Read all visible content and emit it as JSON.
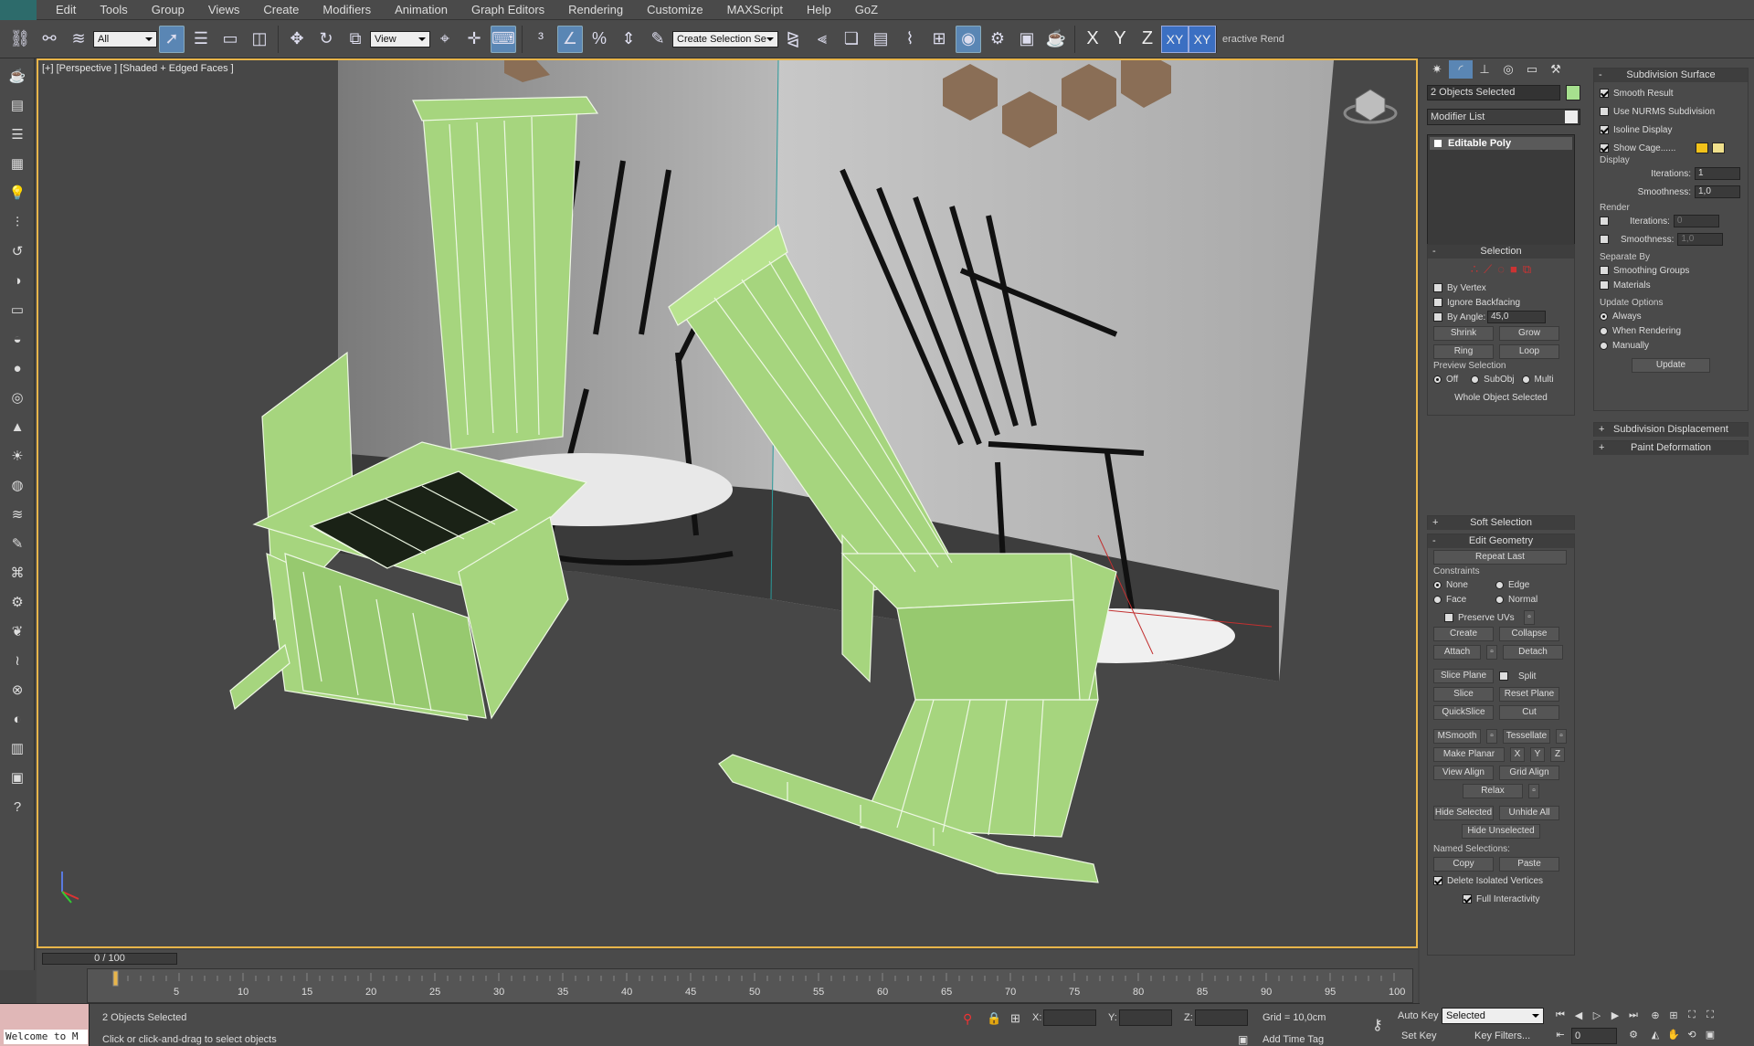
{
  "menu": [
    "Edit",
    "Tools",
    "Group",
    "Views",
    "Create",
    "Modifiers",
    "Animation",
    "Graph Editors",
    "Rendering",
    "Customize",
    "MAXScript",
    "Help",
    "GoZ"
  ],
  "toolbar": {
    "selection_filter": "All",
    "ref_coord": "View",
    "named_selection": "Create Selection Se",
    "axis_x": "X",
    "axis_y": "Y",
    "axis_z": "Z",
    "axis_xy": "XY",
    "axis_xy2": "XY",
    "interactive_label": "eractive Rend"
  },
  "viewport": {
    "label": "[+] [Perspective ] [Shaded + Edged Faces ]",
    "accent_color": "#e8b54a",
    "model_color": "#a6d57e"
  },
  "left_tools_icons": [
    "teapot-icon",
    "scene-explorer-icon",
    "layer-icon",
    "grid-icon",
    "light-icon",
    "sliders-icon",
    "rotate-icon",
    "material-icon",
    "box-icon",
    "half-sphere-icon",
    "sphere-icon",
    "torus-icon",
    "cone-icon",
    "sun-icon",
    "sphere2-icon",
    "hair-icon",
    "paint-icon",
    "cloth-icon",
    "settings-icon",
    "plant-icon",
    "hair2-icon",
    "xform-icon",
    "globe-icon",
    "grid2-icon",
    "render-icon",
    "help-icon"
  ],
  "timeline": {
    "frame": "0 / 100",
    "ticks": [
      "5",
      "10",
      "15",
      "20",
      "25",
      "30",
      "35",
      "40",
      "45",
      "50",
      "55",
      "60",
      "65",
      "70",
      "75",
      "80",
      "85",
      "90",
      "95",
      "100"
    ]
  },
  "status": {
    "maxscript": "Welcome to M",
    "selected": "2 Objects Selected",
    "prompt": "Click or click-and-drag to select objects",
    "x_label": "X:",
    "y_label": "Y:",
    "z_label": "Z:",
    "grid": "Grid = 10,0cm",
    "add_time_tag": "Add Time Tag",
    "auto_key": "Auto Key",
    "set_key": "Set Key",
    "key_mode": "Selected",
    "key_filters": "Key Filters...",
    "frame_field": "0"
  },
  "command_panel": {
    "name_field": "2 Objects Selected",
    "modifier_list": "Modifier List",
    "stack_item": "Editable Poly",
    "selection": {
      "title": "Selection",
      "by_vertex": "By Vertex",
      "ignore_backfacing": "Ignore Backfacing",
      "by_angle": "By Angle:",
      "angle_value": "45,0",
      "shrink": "Shrink",
      "grow": "Grow",
      "ring": "Ring",
      "loop": "Loop",
      "preview_selection": "Preview Selection",
      "off": "Off",
      "subobj": "SubObj",
      "multi": "Multi",
      "whole_object": "Whole Object Selected"
    },
    "soft_selection": "Soft Selection",
    "edit_geometry": {
      "title": "Edit Geometry",
      "repeat_last": "Repeat Last",
      "constraints": "Constraints",
      "none": "None",
      "edge": "Edge",
      "face": "Face",
      "normal": "Normal",
      "preserve_uvs": "Preserve UVs",
      "create": "Create",
      "collapse": "Collapse",
      "attach": "Attach",
      "detach": "Detach",
      "slice_plane": "Slice Plane",
      "split": "Split",
      "slice": "Slice",
      "reset_plane": "Reset Plane",
      "quickslice": "QuickSlice",
      "cut": "Cut",
      "msmooth": "MSmooth",
      "tessellate": "Tessellate",
      "make_planar": "Make Planar",
      "x": "X",
      "y": "Y",
      "z": "Z",
      "view_align": "View Align",
      "grid_align": "Grid Align",
      "relax": "Relax",
      "hide_selected": "Hide Selected",
      "unhide_all": "Unhide All",
      "hide_unselected": "Hide Unselected",
      "named_selections": "Named Selections:",
      "copy": "Copy",
      "paste": "Paste",
      "delete_isolated": "Delete Isolated Vertices",
      "full_interactivity": "Full Interactivity"
    },
    "subdivision": {
      "title": "Subdivision Surface",
      "smooth_result": "Smooth Result",
      "use_nurms": "Use NURMS Subdivision",
      "isoline": "Isoline Display",
      "show_cage": "Show Cage......",
      "display": "Display",
      "iterations": "Iterations:",
      "iterations_value": "1",
      "smoothness": "Smoothness:",
      "smoothness_value": "1,0",
      "render": "Render",
      "r_iterations_value": "0",
      "r_smoothness_value": "1,0",
      "separate_by": "Separate By",
      "smoothing_groups": "Smoothing Groups",
      "materials": "Materials",
      "update_options": "Update Options",
      "always": "Always",
      "when_rendering": "When Rendering",
      "manually": "Manually",
      "update": "Update",
      "cage_color1": "#f2c21a",
      "cage_color2": "#f0e08c"
    },
    "subdivision_displacement": "Subdivision Displacement",
    "paint_deformation": "Paint Deformation"
  }
}
